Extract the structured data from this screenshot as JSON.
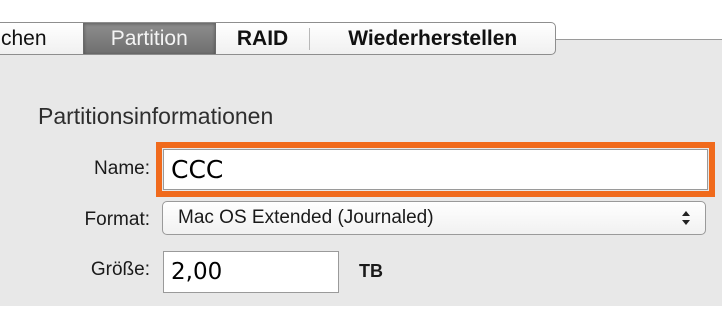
{
  "tabs": [
    {
      "label": "chen",
      "selected": false
    },
    {
      "label": "Partition",
      "selected": true
    },
    {
      "label": "RAID",
      "selected": false
    },
    {
      "label": "Wiederherstellen",
      "selected": false
    }
  ],
  "section": {
    "title": "Partitionsinformationen"
  },
  "fields": {
    "name_label": "Name:",
    "name_value": "CCC",
    "format_label": "Format:",
    "format_value": "Mac OS Extended (Journaled)",
    "size_label": "Größe:",
    "size_value": "2,00",
    "size_unit": "TB"
  },
  "colors": {
    "highlight": "#f06a1c",
    "panel_background": "#e8e8e8",
    "selected_tab": "#7a7a7a"
  },
  "icons": {
    "format_select_arrows": "up-down-arrows-icon"
  }
}
